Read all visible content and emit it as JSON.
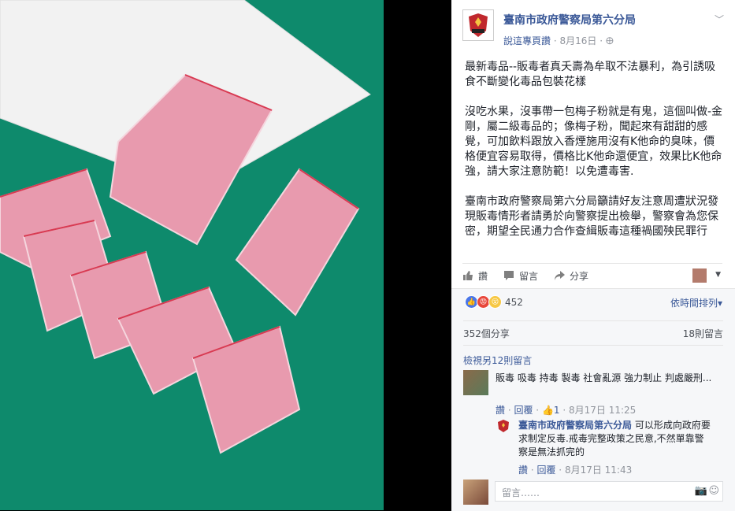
{
  "page": {
    "name": "臺南市政府警察局第六分局",
    "meta_link": "說這專頁讚",
    "date": "8月16日",
    "avatar_text": "POLICE"
  },
  "post": {
    "paragraphs": [
      "最新毒品--販毒者真夭壽為牟取不法暴利，為引誘吸食不斷變化毒品包裝花樣",
      "沒吃水果，沒事帶一包梅子粉就是有鬼，這個叫做-金剛，屬二級毒品的；像梅子粉，聞起來有甜甜的感覺，可加飲料跟放入香煙施用沒有K他命的臭味，價格便宜容易取得，價格比K他命還便宜，效果比K他命強，請大家注意防範！以免遭毒害.",
      "臺南市政府警察局第六分局籲請好友注意周遭狀況發現販毒情形者請勇於向警察提出檢舉，警察會為您保密，期望全民通力合作查緝販毒這種禍國殃民罪行"
    ]
  },
  "actions": {
    "like": "讚",
    "comment": "留言",
    "share": "分享"
  },
  "reactions": {
    "count": "452",
    "sort": "依時間排列"
  },
  "stats": {
    "shares": "352個分享",
    "comments": "18則留言"
  },
  "more_comments": "檢視另12則留言",
  "comment1": {
    "text": "販毒 吸毒 持毒 製毒 社會亂源 強力制止 判處嚴刑...",
    "like": "讚",
    "reply": "回覆",
    "likes": "1",
    "time": "8月17日 11:25"
  },
  "reply1": {
    "name": "臺南市政府警察局第六分局",
    "text": "可以形成向政府要求制定反毒.戒毒完整政策之民意,不然單靠警察是無法抓完的",
    "like": "讚",
    "reply": "回覆",
    "time": "8月17日 11:43"
  },
  "comment_input": {
    "placeholder": "留言……"
  },
  "colors": {
    "link": "#3b5998",
    "table_green": "#0e8a6c",
    "packet_pink": "#e89aae"
  }
}
